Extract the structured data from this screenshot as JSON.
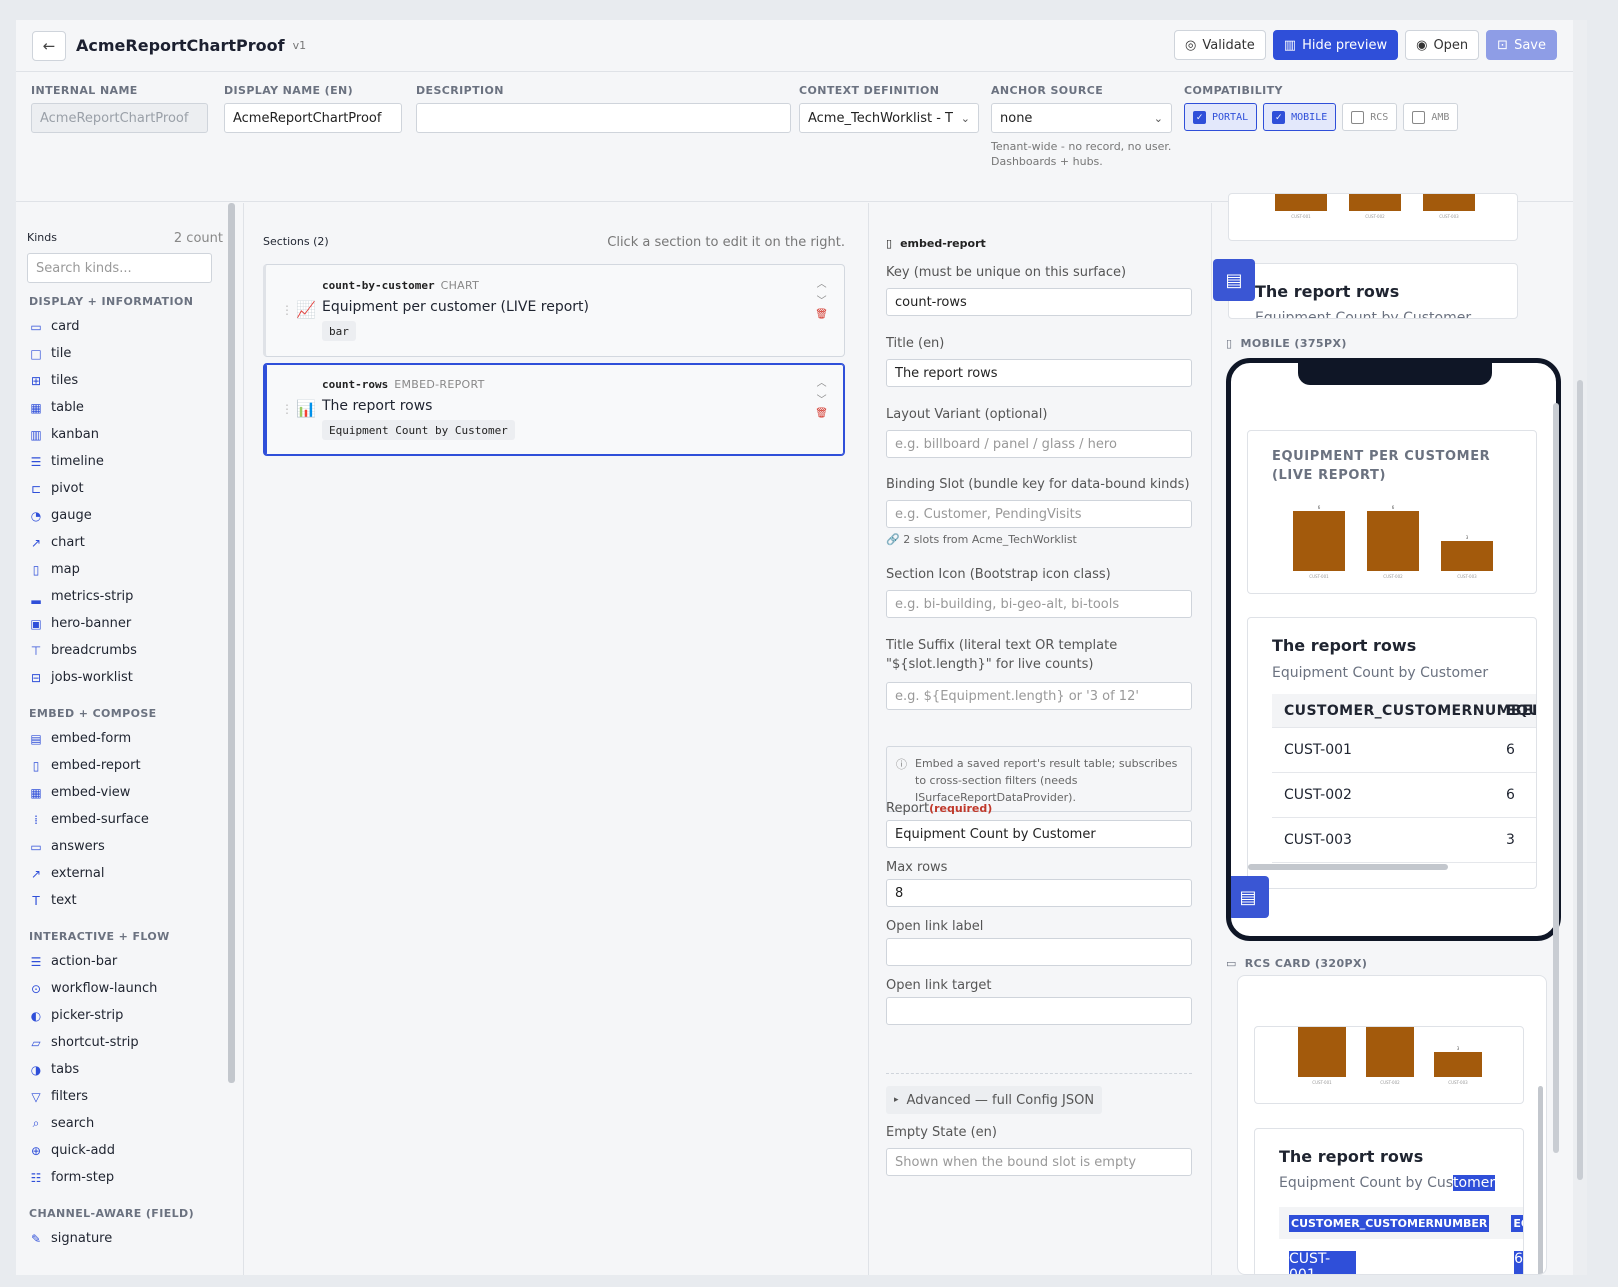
{
  "header": {
    "title": "AcmeReportChartProof",
    "version": "v1",
    "validate_label": "Validate",
    "hide_preview_label": "Hide preview",
    "open_label": "Open",
    "save_label": "Save"
  },
  "fields": {
    "internal_name": {
      "label": "INTERNAL NAME",
      "value": "AcmeReportChartProof"
    },
    "display_name": {
      "label": "DISPLAY NAME (EN)",
      "value": "AcmeReportChartProof"
    },
    "description": {
      "label": "DESCRIPTION",
      "value": ""
    },
    "context_definition": {
      "label": "CONTEXT DEFINITION",
      "value": "Acme_TechWorklist - T"
    },
    "anchor_source": {
      "label": "ANCHOR SOURCE",
      "value": "none",
      "help": "Tenant-wide - no record, no user. Dashboards + hubs."
    },
    "compatibility": {
      "label": "COMPATIBILITY",
      "options": [
        {
          "label": "PORTAL",
          "checked": true
        },
        {
          "label": "MOBILE",
          "checked": true
        },
        {
          "label": "RCS",
          "checked": false
        },
        {
          "label": "AMB",
          "checked": false
        }
      ]
    }
  },
  "kinds": {
    "title": "Kinds",
    "count": "2 count",
    "search_placeholder": "Search kinds...",
    "groups": [
      {
        "name": "DISPLAY + INFORMATION",
        "items": [
          {
            "label": "card",
            "icon": "card-icon"
          },
          {
            "label": "tile",
            "icon": "square-icon"
          },
          {
            "label": "tiles",
            "icon": "grid-icon"
          },
          {
            "label": "table",
            "icon": "table-icon"
          },
          {
            "label": "kanban",
            "icon": "kanban-icon"
          },
          {
            "label": "timeline",
            "icon": "list-icon"
          },
          {
            "label": "pivot",
            "icon": "pivot-icon"
          },
          {
            "label": "gauge",
            "icon": "gauge-icon"
          },
          {
            "label": "chart",
            "icon": "line-chart-icon"
          },
          {
            "label": "map",
            "icon": "map-icon"
          },
          {
            "label": "metrics-strip",
            "icon": "bar-chart-icon"
          },
          {
            "label": "hero-banner",
            "icon": "image-icon"
          },
          {
            "label": "breadcrumbs",
            "icon": "signpost-icon"
          },
          {
            "label": "jobs-worklist",
            "icon": "briefcase-icon"
          }
        ]
      },
      {
        "name": "EMBED + COMPOSE",
        "items": [
          {
            "label": "embed-form",
            "icon": "form-icon"
          },
          {
            "label": "embed-report",
            "icon": "report-icon"
          },
          {
            "label": "embed-view",
            "icon": "table-icon"
          },
          {
            "label": "embed-surface",
            "icon": "grid-dots-icon"
          },
          {
            "label": "answers",
            "icon": "card-icon"
          },
          {
            "label": "external",
            "icon": "external-link-icon"
          },
          {
            "label": "text",
            "icon": "text-icon"
          }
        ]
      },
      {
        "name": "INTERACTIVE + FLOW",
        "items": [
          {
            "label": "action-bar",
            "icon": "list-icon"
          },
          {
            "label": "workflow-launch",
            "icon": "play-circle-icon"
          },
          {
            "label": "picker-strip",
            "icon": "toggles-icon"
          },
          {
            "label": "shortcut-strip",
            "icon": "collection-icon"
          },
          {
            "label": "tabs",
            "icon": "toggle-icon"
          },
          {
            "label": "filters",
            "icon": "funnel-icon"
          },
          {
            "label": "search",
            "icon": "search-icon"
          },
          {
            "label": "quick-add",
            "icon": "plus-circle-icon"
          },
          {
            "label": "form-step",
            "icon": "ui-checks-icon"
          }
        ]
      },
      {
        "name": "CHANNEL-AWARE (FIELD)",
        "items": [
          {
            "label": "signature",
            "icon": "pen-icon"
          }
        ]
      }
    ]
  },
  "sections": {
    "title": "Sections (2)",
    "hint": "Click a section to edit it on the right.",
    "items": [
      {
        "key": "count-by-customer",
        "kind": "CHART",
        "title": "Equipment per customer (LIVE report)",
        "tag": "bar"
      },
      {
        "key": "count-rows",
        "kind": "EMBED-REPORT",
        "title": "The report rows",
        "tag": "Equipment Count by Customer"
      }
    ]
  },
  "editor": {
    "type": "embed-report",
    "key": {
      "label": "Key (must be unique on this surface)",
      "value": "count-rows"
    },
    "title": {
      "label": "Title (en)",
      "value": "The report rows"
    },
    "layout_variant": {
      "label": "Layout Variant (optional)",
      "placeholder": "e.g. billboard / panel / glass / hero"
    },
    "binding_slot": {
      "label": "Binding Slot (bundle key for data-bound kinds)",
      "placeholder": "e.g. Customer, PendingVisits",
      "note": "2 slots from Acme_TechWorklist"
    },
    "section_icon": {
      "label": "Section Icon (Bootstrap icon class)",
      "placeholder": "e.g. bi-building, bi-geo-alt, bi-tools"
    },
    "title_suffix": {
      "label": "Title Suffix (literal text OR template \"${slot.length}\" for live counts)",
      "placeholder": "e.g. ${Equipment.length} or '3 of 12'"
    },
    "info": "Embed a saved report's result table; subscribes to cross-section filters (needs ISurfaceReportDataProvider).",
    "report": {
      "label": "Report",
      "required": "(required)",
      "value": "Equipment Count by Customer"
    },
    "max_rows": {
      "label": "Max rows",
      "value": "8"
    },
    "open_link_label": {
      "label": "Open link label",
      "value": ""
    },
    "open_link_target": {
      "label": "Open link target",
      "value": ""
    },
    "advanced": "Advanced — full Config JSON",
    "empty_state": {
      "label": "Empty State (en)",
      "placeholder": "Shown when the bound slot is empty"
    }
  },
  "preview": {
    "top_card_title": "The report rows",
    "top_card_sub": "Equipment Count by Customer",
    "mobile_label": "MOBILE (375PX)",
    "rcs_label": "RCS CARD (320PX)",
    "chart_title": "EQUIPMENT PER CUSTOMER (LIVE REPORT)",
    "report_title": "The report rows",
    "report_sub": "Equipment Count by Customer",
    "report_sub_a": "Equipment Count by Cus",
    "report_sub_b": "tomer",
    "col1": "CUSTOMER_CUSTOMERNUMBER",
    "col2": "EQUI",
    "col2_rcs": "EQ",
    "rows": [
      {
        "customer": "CUST-001",
        "count": "6"
      },
      {
        "customer": "CUST-002",
        "count": "6"
      },
      {
        "customer": "CUST-003",
        "count": "3"
      }
    ],
    "rcs_row1": "CUST-001",
    "rcs_row1_count": "6"
  },
  "chart_data": {
    "type": "bar",
    "categories": [
      "CUST-001",
      "CUST-002",
      "CUST-003"
    ],
    "values": [
      6,
      6,
      3
    ],
    "title": "EQUIPMENT PER CUSTOMER (LIVE REPORT)",
    "xlabel": "",
    "ylabel": "",
    "ylim": [
      0,
      6
    ],
    "bar_color": "#a35a0c"
  },
  "colors": {
    "accent": "#2f4fd9",
    "danger": "#d43a2f",
    "bar": "#a35a0c"
  }
}
